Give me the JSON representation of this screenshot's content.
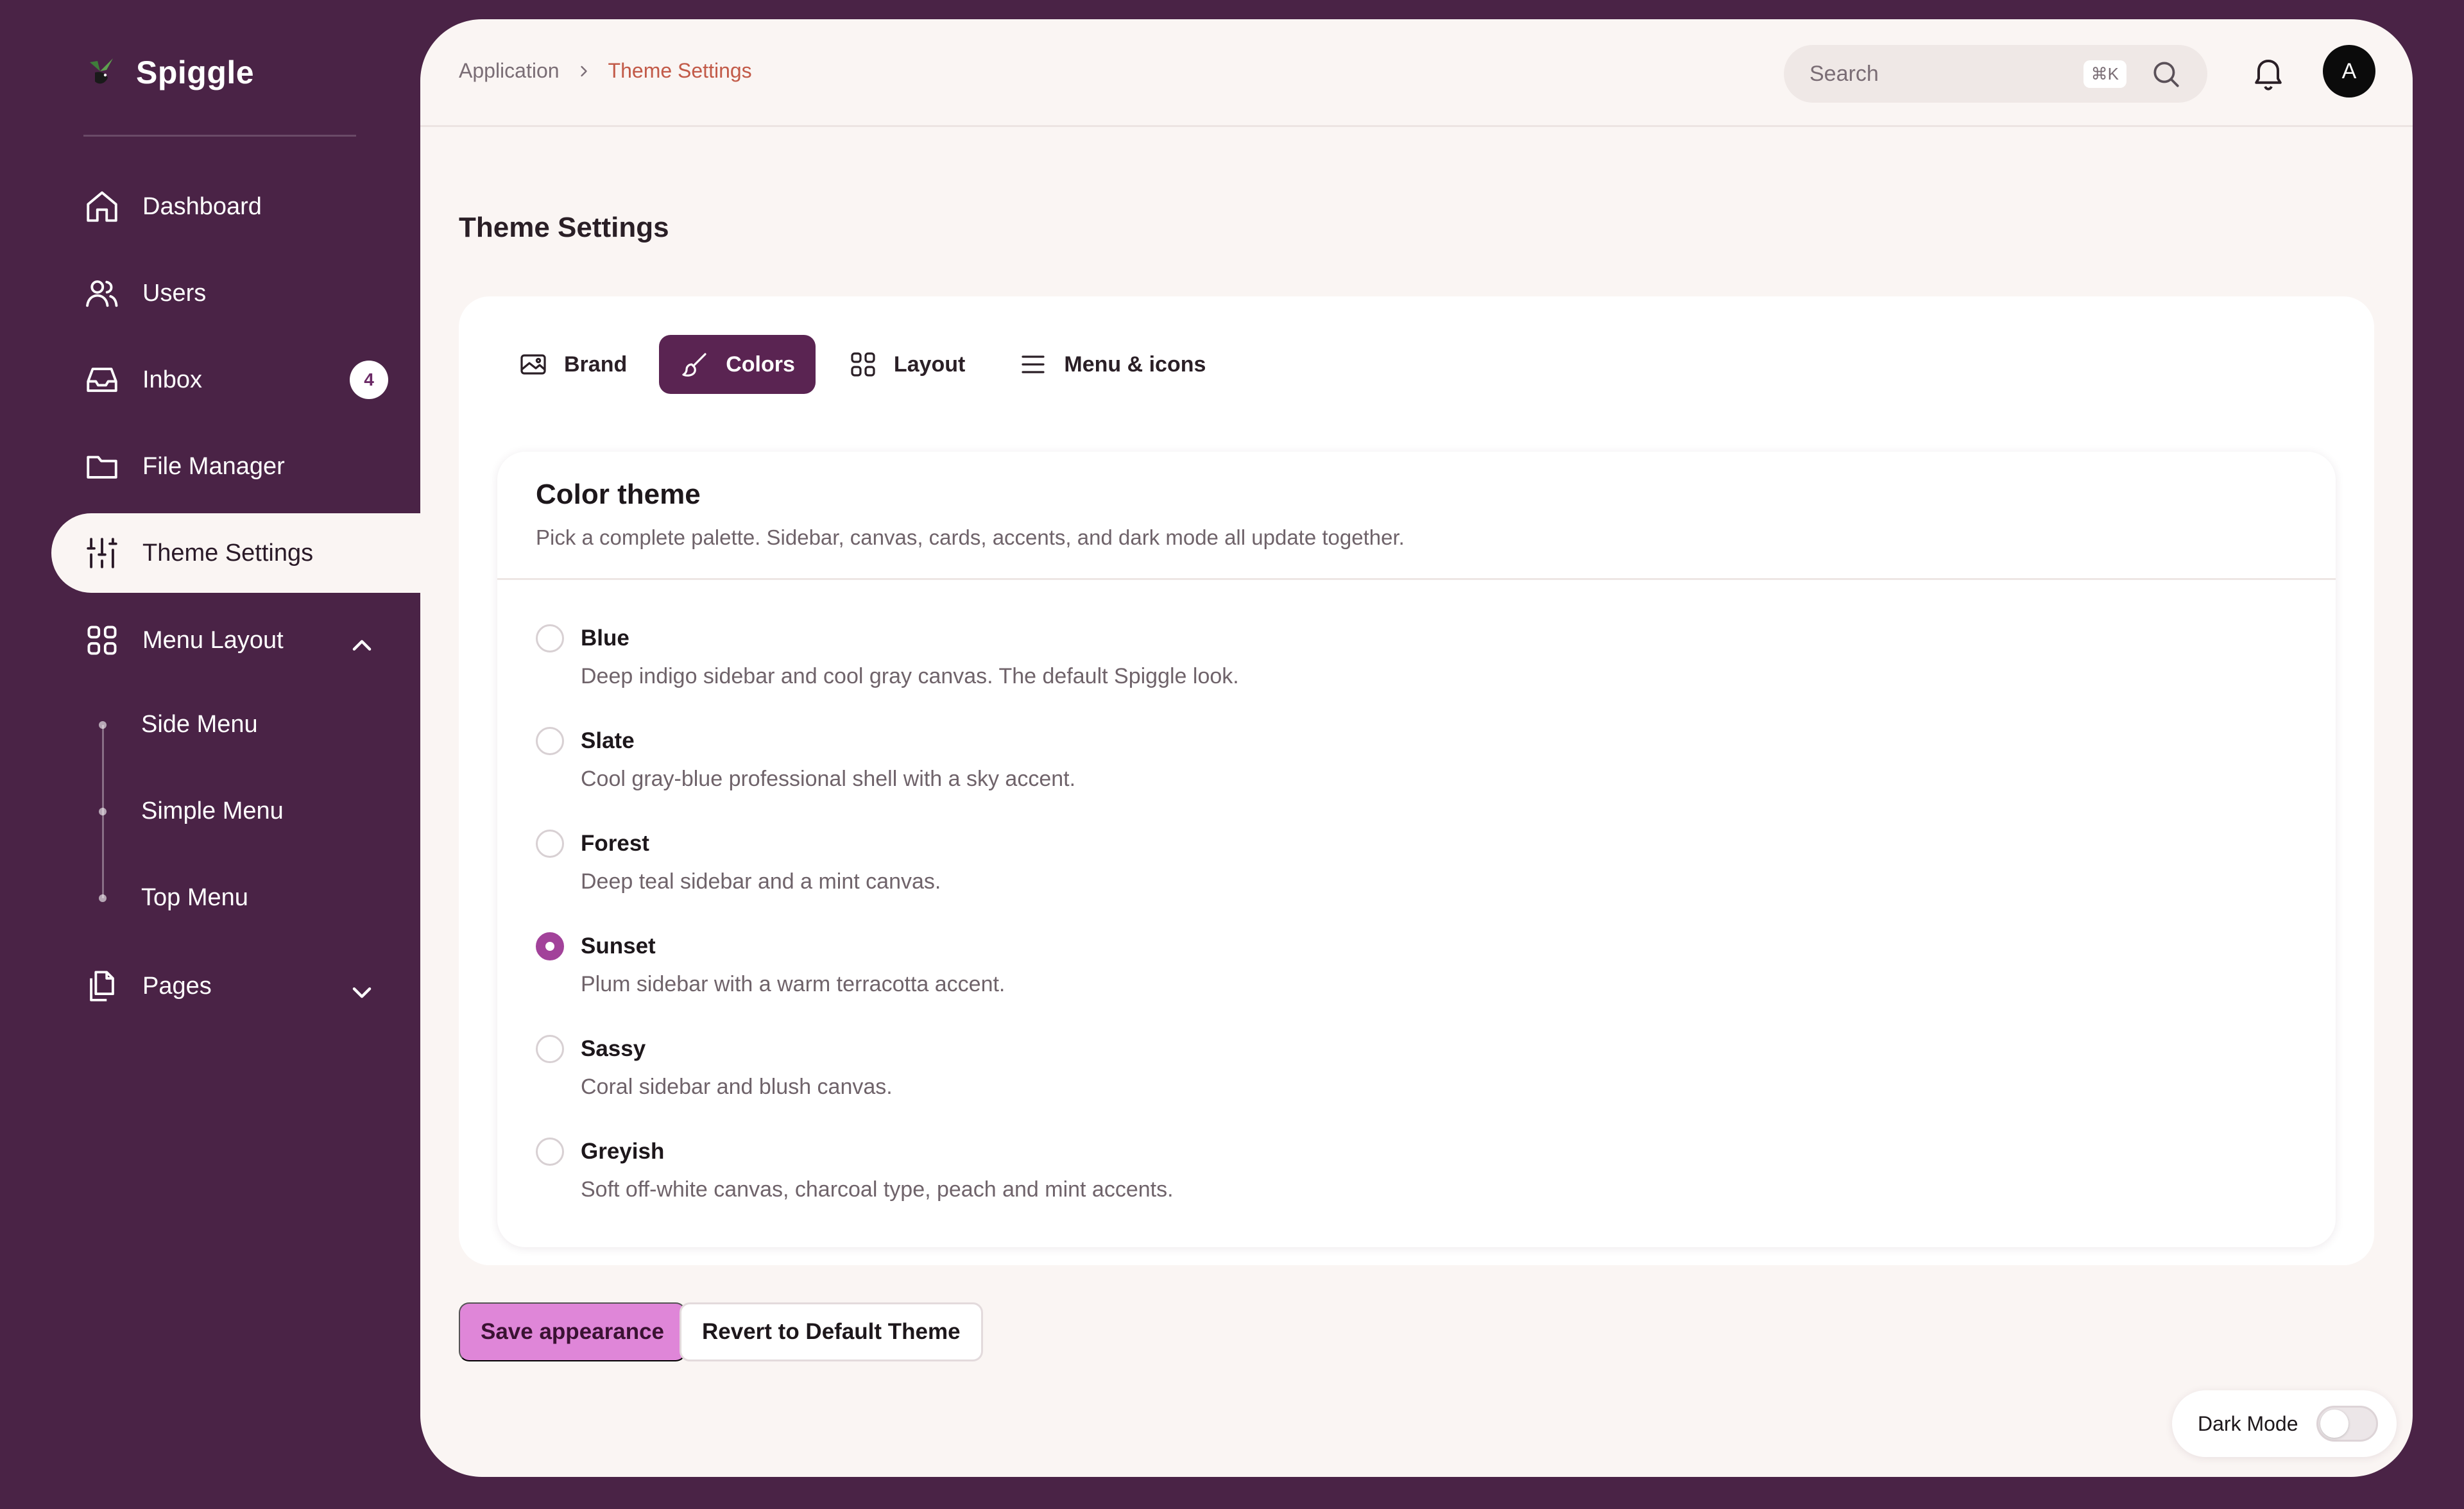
{
  "brand": {
    "name": "Spiggle"
  },
  "sidebar": {
    "items": [
      {
        "label": "Dashboard",
        "icon": "home-icon"
      },
      {
        "label": "Users",
        "icon": "users-icon"
      },
      {
        "label": "Inbox",
        "icon": "inbox-icon",
        "badge": "4"
      },
      {
        "label": "File Manager",
        "icon": "folder-icon"
      },
      {
        "label": "Theme Settings",
        "icon": "sliders-icon",
        "active": true
      },
      {
        "label": "Menu Layout",
        "icon": "grid-icon",
        "expanded": true
      },
      {
        "label": "Pages",
        "icon": "pages-icon",
        "expanded": false
      }
    ],
    "menu_layout_children": [
      "Side Menu",
      "Simple Menu",
      "Top Menu"
    ]
  },
  "header": {
    "breadcrumb": [
      "Application",
      "Theme Settings"
    ],
    "search_placeholder": "Search",
    "search_shortcut": "⌘K",
    "avatar_initial": "A"
  },
  "page": {
    "title": "Theme Settings",
    "tabs": [
      {
        "label": "Brand",
        "icon": "image-icon"
      },
      {
        "label": "Colors",
        "icon": "brush-icon",
        "active": true
      },
      {
        "label": "Layout",
        "icon": "grid-icon"
      },
      {
        "label": "Menu & icons",
        "icon": "menu-icon"
      }
    ],
    "color_theme": {
      "title": "Color theme",
      "subtitle": "Pick a complete palette. Sidebar, canvas, cards, accents, and dark mode all update together.",
      "options": [
        {
          "name": "Blue",
          "desc": "Deep indigo sidebar and cool gray canvas. The default Spiggle look.",
          "selected": false
        },
        {
          "name": "Slate",
          "desc": "Cool gray-blue professional shell with a sky accent.",
          "selected": false
        },
        {
          "name": "Forest",
          "desc": "Deep teal sidebar and a mint canvas.",
          "selected": false
        },
        {
          "name": "Sunset",
          "desc": "Plum sidebar with a warm terracotta accent.",
          "selected": true
        },
        {
          "name": "Sassy",
          "desc": "Coral sidebar and blush canvas.",
          "selected": false
        },
        {
          "name": "Greyish",
          "desc": "Soft off-white canvas, charcoal type, peach and mint accents.",
          "selected": false
        }
      ]
    },
    "actions": {
      "save": "Save appearance",
      "revert": "Revert to Default Theme"
    }
  },
  "dark_mode": {
    "label": "Dark Mode",
    "enabled": false
  },
  "colors": {
    "sidebar": "#4a2346",
    "canvas": "#faf5f3",
    "accent": "#c25a48",
    "tab_active": "#5a2452",
    "radio_selected": "#a2429a",
    "save_button": "#df86d8"
  }
}
